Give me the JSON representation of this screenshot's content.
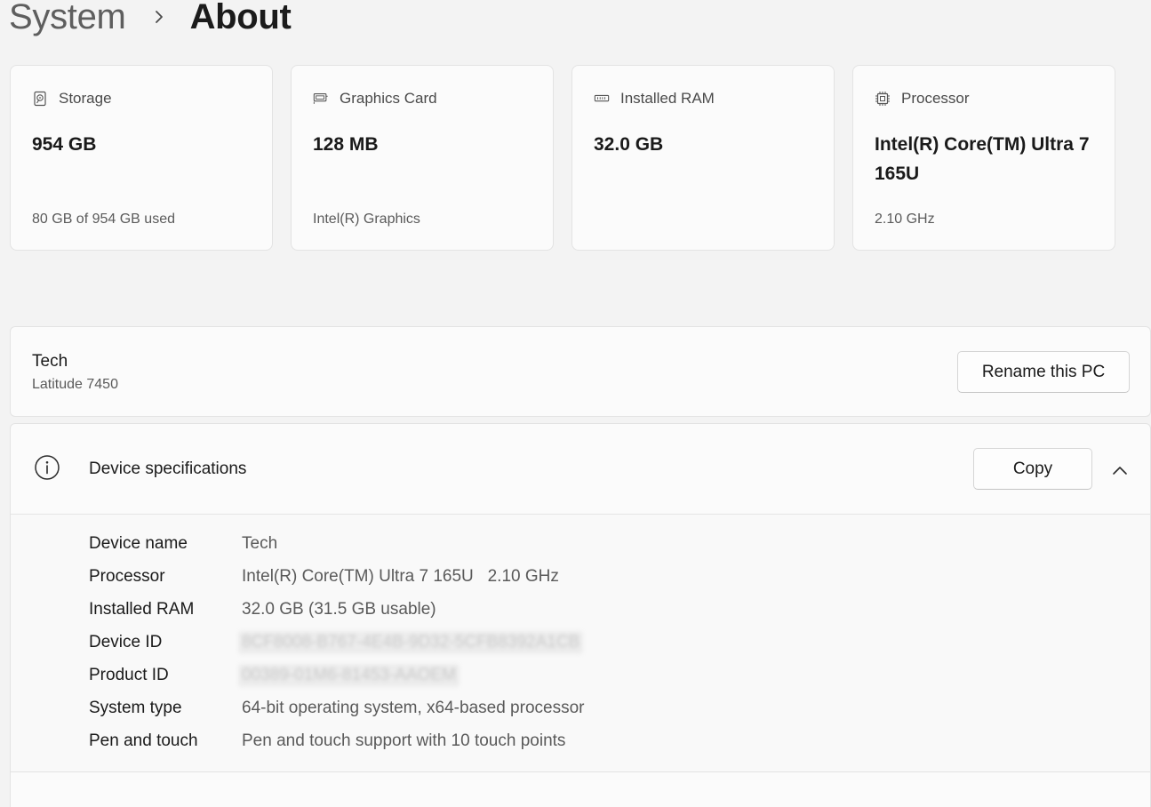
{
  "breadcrumb": {
    "parent": "System",
    "current": "About"
  },
  "cards": [
    {
      "icon": "hard-drive-icon",
      "label": "Storage",
      "value": "954 GB",
      "sub": "80 GB of 954 GB used"
    },
    {
      "icon": "graphics-card-icon",
      "label": "Graphics Card",
      "value": "128 MB",
      "sub": "Intel(R) Graphics"
    },
    {
      "icon": "memory-icon",
      "label": "Installed RAM",
      "value": "32.0 GB",
      "sub": ""
    },
    {
      "icon": "processor-icon",
      "label": "Processor",
      "value": "Intel(R) Core(TM) Ultra 7 165U",
      "sub": "2.10 GHz"
    }
  ],
  "pc": {
    "name": "Tech",
    "model": "Latitude 7450",
    "rename_label": "Rename this PC"
  },
  "specs": {
    "title": "Device specifications",
    "copy_label": "Copy",
    "rows": [
      {
        "label": "Device name",
        "value": "Tech"
      },
      {
        "label": "Processor",
        "value": "Intel(R) Core(TM) Ultra 7 165U   2.10 GHz"
      },
      {
        "label": "Installed RAM",
        "value": "32.0 GB (31.5 GB usable)"
      },
      {
        "label": "Device ID",
        "value": "8CF8008-B767-4E4B-9D32-5CFB8392A1CB"
      },
      {
        "label": "Product ID",
        "value": "00389-01M6-81453-AAOEM"
      },
      {
        "label": "System type",
        "value": "64-bit operating system, x64-based processor"
      },
      {
        "label": "Pen and touch",
        "value": "Pen and touch support with 10 touch points"
      }
    ]
  },
  "colors": {
    "background": "#f3f3f3",
    "card": "#fbfbfb",
    "border": "#e3e3e3",
    "text_primary": "#1a1a1a",
    "text_secondary": "#5a5a5a"
  }
}
